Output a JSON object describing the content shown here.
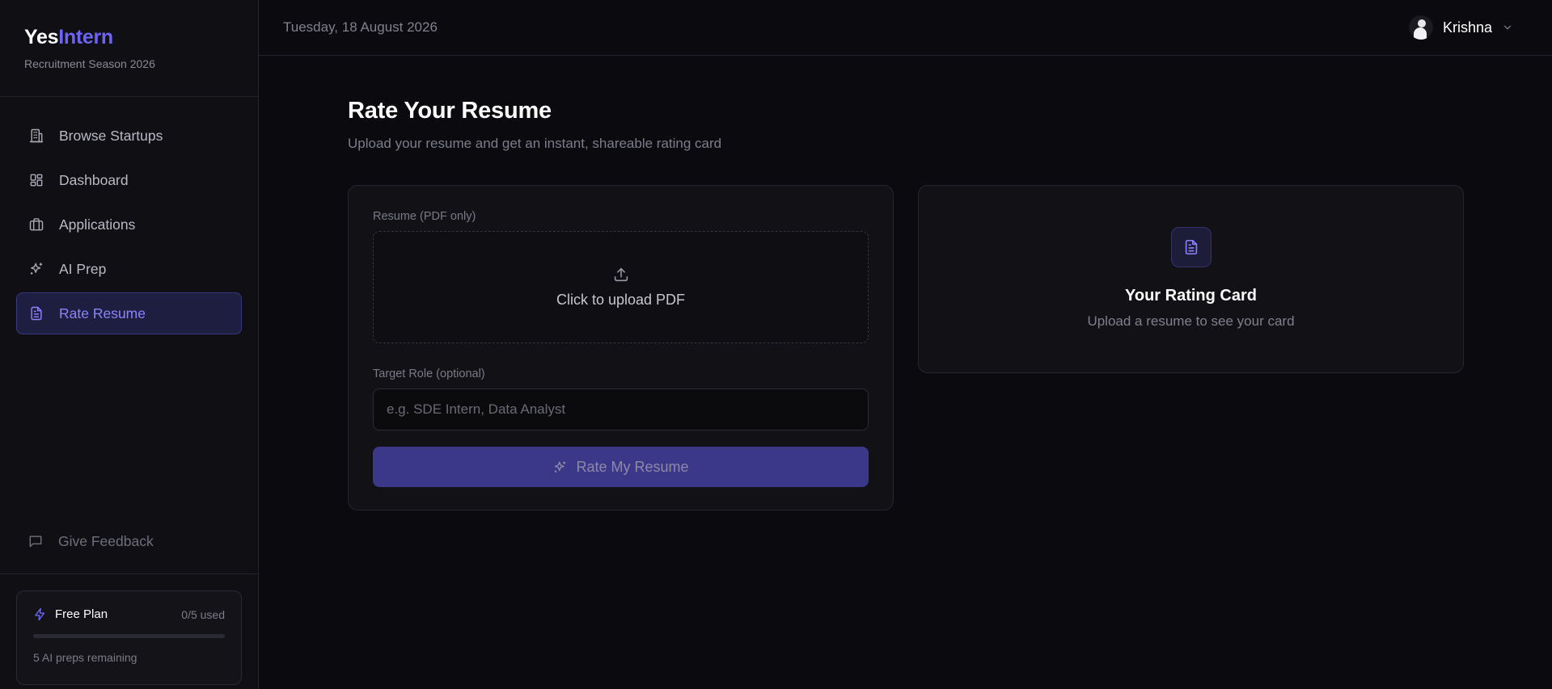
{
  "brand": {
    "name_a": "Yes",
    "name_b": "Intern",
    "season": "Recruitment Season 2026"
  },
  "sidebar": {
    "items": [
      {
        "label": "Browse Startups",
        "icon": "building-icon"
      },
      {
        "label": "Dashboard",
        "icon": "dashboard-icon"
      },
      {
        "label": "Applications",
        "icon": "briefcase-icon"
      },
      {
        "label": "AI Prep",
        "icon": "sparkles-icon"
      },
      {
        "label": "Rate Resume",
        "icon": "document-icon",
        "active": true
      }
    ],
    "feedback": "Give Feedback"
  },
  "plan": {
    "name": "Free Plan",
    "used": "0/5 used",
    "progress_fraction": 0,
    "remaining": "5 AI preps remaining"
  },
  "topbar": {
    "date": "Tuesday, 18 August 2026",
    "user": "Krishna"
  },
  "page": {
    "title": "Rate Your Resume",
    "subtitle": "Upload your resume and get an instant, shareable rating card"
  },
  "form": {
    "resume_label": "Resume (PDF only)",
    "upload_text": "Click to upload PDF",
    "role_label": "Target Role (optional)",
    "role_placeholder": "e.g. SDE Intern, Data Analyst",
    "submit": "Rate My Resume"
  },
  "rating_card": {
    "title": "Your Rating Card",
    "subtitle": "Upload a resume to see your card"
  },
  "colors": {
    "accent": "#6d63f5",
    "background": "#0b0b0f",
    "sidebar": "#101014"
  }
}
